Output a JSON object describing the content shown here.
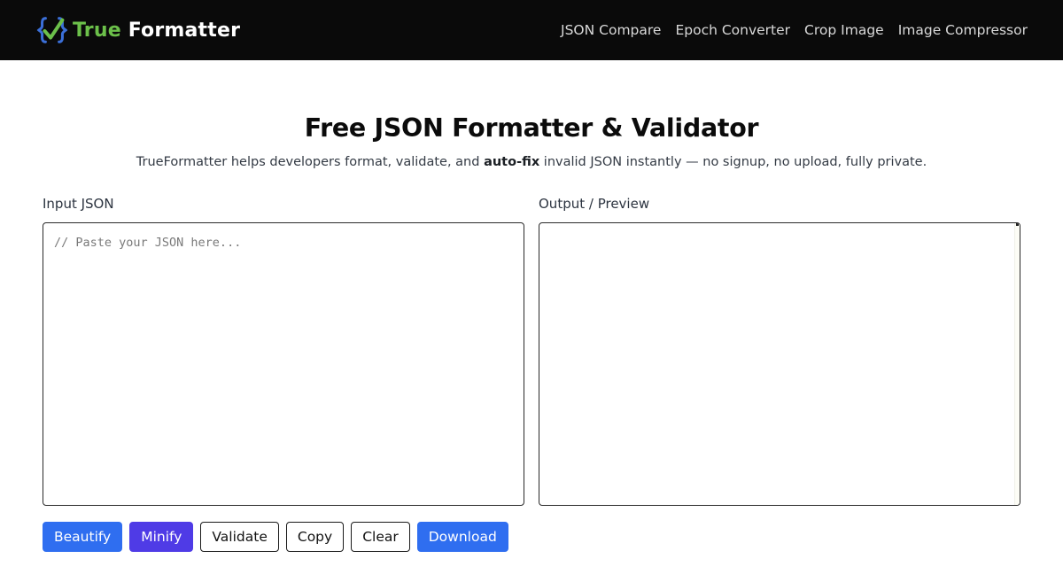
{
  "header": {
    "brand": {
      "accent_text": "True",
      "main_text": "Formatter",
      "logo_icon": "check-braces-logo-icon",
      "accent_color": "#6cc04a"
    },
    "nav": [
      {
        "label": "JSON Compare"
      },
      {
        "label": "Epoch Converter"
      },
      {
        "label": "Crop Image"
      },
      {
        "label": "Image Compressor"
      }
    ]
  },
  "main": {
    "title": "Free JSON Formatter & Validator",
    "subtitle": {
      "before": "TrueFormatter helps developers format, validate, and ",
      "bold": "auto-fix",
      "after": " invalid JSON instantly — no signup, no upload, fully private."
    },
    "input": {
      "label": "Input JSON",
      "placeholder": "// Paste your JSON here...",
      "value": ""
    },
    "output": {
      "label": "Output / Preview",
      "value": ""
    },
    "buttons": {
      "beautify": "Beautify",
      "minify": "Minify",
      "validate": "Validate",
      "copy": "Copy",
      "clear": "Clear",
      "download": "Download"
    }
  },
  "colors": {
    "navbar_bg": "#0a0a0a",
    "primary_button": "#2f6ef0",
    "minify_button": "#4f3be6"
  }
}
